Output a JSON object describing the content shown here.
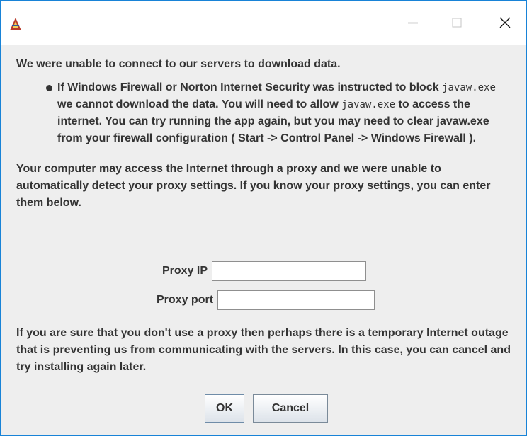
{
  "window": {
    "icons": {
      "app": "java-app-icon",
      "minimize": "minimize-icon",
      "maximize": "maximize-icon",
      "close": "close-icon"
    }
  },
  "message": {
    "intro": "We were unable to connect to our servers to download data.",
    "bullet_part1": "If Windows Firewall or Norton Internet Security was instructed to block ",
    "bullet_code1": "javaw.exe",
    "bullet_part2": " we cannot download the data. You will need to allow ",
    "bullet_code2": "javaw.exe",
    "bullet_part3": " to access the internet. You can try running the app again, but you may need to clear javaw.exe from your firewall configuration ( Start -> Control Panel -> Windows Firewall ).",
    "proxy_text": "Your computer may access the Internet through a proxy and we were unable to automatically detect your proxy settings. If you know your proxy settings, you can enter them below.",
    "outage_text": "If you are sure that you don't use a proxy then perhaps there is a temporary Internet outage that is preventing us from communicating with the servers. In this case, you can cancel and try installing again later."
  },
  "form": {
    "proxy_ip_label": "Proxy IP",
    "proxy_ip_value": "",
    "proxy_port_label": "Proxy port",
    "proxy_port_value": ""
  },
  "buttons": {
    "ok": "OK",
    "cancel": "Cancel"
  },
  "colors": {
    "window_border": "#1883d7",
    "background": "#eeeeee",
    "text": "#333333"
  }
}
